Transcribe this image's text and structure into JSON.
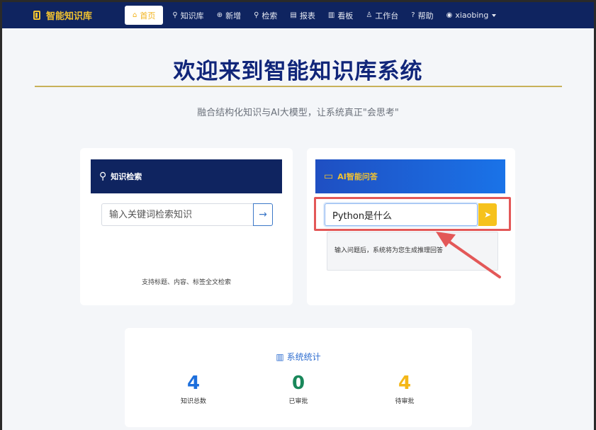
{
  "navbar": {
    "brand": "智能知识库",
    "items": [
      {
        "label": "首页",
        "icon": "home-icon",
        "glyph": "⌂",
        "active": true
      },
      {
        "label": "知识库",
        "icon": "search-icon",
        "glyph": "⚲"
      },
      {
        "label": "新增",
        "icon": "plus-circle-icon",
        "glyph": "⊕"
      },
      {
        "label": "检索",
        "icon": "search-icon",
        "glyph": "⚲"
      },
      {
        "label": "报表",
        "icon": "report-icon",
        "glyph": "▤"
      },
      {
        "label": "看板",
        "icon": "bar-chart-icon",
        "glyph": "▥"
      },
      {
        "label": "工作台",
        "icon": "user-icon",
        "glyph": "♙"
      },
      {
        "label": "帮助",
        "icon": "help-icon",
        "glyph": "?"
      }
    ],
    "user": "xiaobing"
  },
  "hero": {
    "title": "欢迎来到智能知识库系统",
    "subtitle": "融合结构化知识与AI大模型，让系统真正\"会思考\""
  },
  "search_card": {
    "title": "知识检索",
    "placeholder": "输入关键词检索知识",
    "hint": "支持标题、内容、标签全文检索"
  },
  "ask_card": {
    "title": "AI智能问答",
    "value": "Python是什么",
    "answer_hint": "输入问题后，系统将为您生成推理回答"
  },
  "stats": {
    "title": "系统统计",
    "items": [
      {
        "value": "4",
        "label": "知识总数"
      },
      {
        "value": "0",
        "label": "已审批"
      },
      {
        "value": "4",
        "label": "待审批"
      }
    ]
  }
}
